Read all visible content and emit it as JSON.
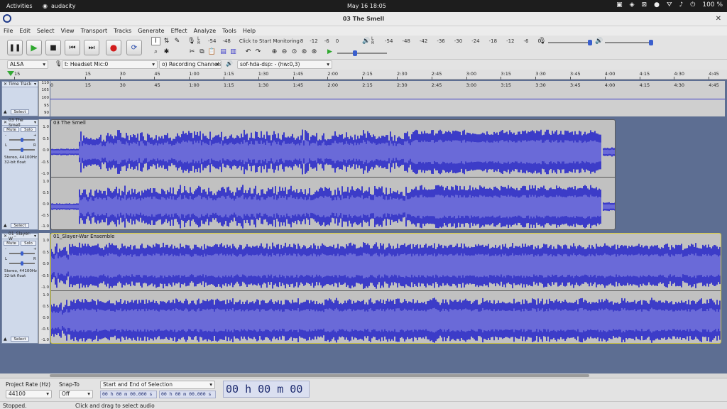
{
  "topbar": {
    "activities": "Activities",
    "app_name": "audacity",
    "clock": "May 16  18:05",
    "battery": "100 %"
  },
  "window": {
    "title": "03 The Smell"
  },
  "menu": [
    "File",
    "Edit",
    "Select",
    "View",
    "Transport",
    "Tracks",
    "Generate",
    "Effect",
    "Analyze",
    "Tools",
    "Help"
  ],
  "meters": {
    "record_lr": "L R",
    "record_scale": [
      "-54",
      "-48"
    ],
    "monitor_hint": "Click to Start Monitoring",
    "record_scale_right": [
      "8",
      "-12",
      "-6",
      "0"
    ],
    "play_lr": "L R",
    "play_scale": [
      "-54",
      "-48",
      "-42",
      "-36",
      "-30",
      "-24",
      "-18",
      "-12",
      "-6",
      "0"
    ]
  },
  "device": {
    "host": "ALSA",
    "input": "t: Headset Mic:0",
    "channels": "o) Recording Channels",
    "output": "sof-hda-dsp: - (hw:0,3)"
  },
  "ruler": {
    "start_label": "15",
    "ticks": [
      "0",
      "15",
      "30",
      "45",
      "1:00",
      "1:15",
      "1:30",
      "1:45",
      "2:00",
      "2:15",
      "2:30",
      "2:45",
      "3:00",
      "3:15",
      "3:30",
      "3:45",
      "4:00",
      "4:15",
      "4:30",
      "4:45"
    ]
  },
  "time_track": {
    "name": "Time Track",
    "select_label": "Select",
    "scale": [
      "110",
      "105",
      "100",
      "95",
      "90"
    ]
  },
  "track1": {
    "name": "03 The Smell",
    "clip_name": "03 The Smell",
    "mute": "Mute",
    "solo": "Solo",
    "gain_minus": "-",
    "gain_plus": "+",
    "pan_l": "L",
    "pan_r": "R",
    "info_line1": "Stereo, 44100Hz",
    "info_line2": "32-bit float",
    "select_label": "Select",
    "scale": [
      "1.0",
      "0.5",
      "0.0",
      "-0.5",
      "-1.0"
    ]
  },
  "track2": {
    "name": "01_Slayer-W",
    "clip_name": "01_Slayer-War Ensemble",
    "mute": "Mute",
    "solo": "Solo",
    "gain_minus": "-",
    "gain_plus": "+",
    "pan_l": "L",
    "pan_r": "R",
    "info_line1": "Stereo, 44100Hz",
    "info_line2": "32-bit float",
    "select_label": "Select",
    "scale": [
      "1.0",
      "0.5",
      "0.0",
      "-0.5",
      "-1.0"
    ]
  },
  "selection_bar": {
    "project_rate_label": "Project Rate (Hz)",
    "project_rate_value": "44100",
    "snap_label": "Snap-To",
    "snap_value": "Off",
    "selection_mode": "Start and End of Selection",
    "start_time": "00 h 00 m 00.000 s",
    "end_time": "00 h 00 m 00.000 s",
    "audio_position": "00 h 00 m 00 s"
  },
  "status": {
    "state": "Stopped.",
    "hint": "Click and drag to select audio"
  },
  "colors": {
    "wave": "#3c3cc8",
    "wave_light": "#6a6ad8",
    "clip_bg": "#c1c1c1",
    "track_bg": "#5d6e92"
  }
}
